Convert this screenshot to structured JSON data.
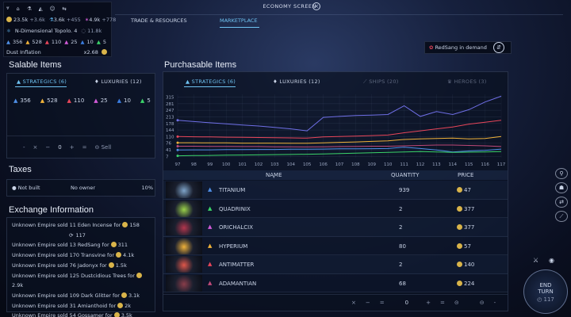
{
  "topbar": {
    "row1": [
      {
        "icon": "fleet-icon",
        "text": ""
      },
      {
        "icon": "city-icon",
        "text": ""
      },
      {
        "icon": "science-icon",
        "text": ""
      },
      {
        "icon": "influence-icon",
        "text": ""
      },
      {
        "icon": "approval-icon",
        "text": ""
      },
      {
        "icon": "diplomacy-icon",
        "text": ""
      }
    ],
    "dust": "23.5k",
    "dust_rate": "+3.6k",
    "science": "3.6k",
    "science_rate": "+455",
    "influence": "4.9k",
    "influence_rate": "+778",
    "research": "N-Dimensional Topolo. 4",
    "research_cost": "11.8k",
    "strategics": [
      {
        "name": "titanium",
        "value": "356",
        "color": "#4f8fe6"
      },
      {
        "name": "quadrinix",
        "value": "528",
        "color": "#f0b23a"
      },
      {
        "name": "orichalcix",
        "value": "110",
        "color": "#e8465a"
      },
      {
        "name": "hyperium",
        "value": "25",
        "color": "#d25bd8"
      },
      {
        "name": "antimatter",
        "value": "10",
        "color": "#3a7de0"
      },
      {
        "name": "adamantian",
        "value": "5",
        "color": "#3bd36a"
      }
    ],
    "dust_inflation_label": "Dust Inflation",
    "dust_inflation_value": "x2.68"
  },
  "header": {
    "title": "ECONOMY SCREEN",
    "tabs": [
      "TRADE & RESOURCES",
      "MARKETPLACE"
    ]
  },
  "demand": {
    "text": "RedSang in demand"
  },
  "salable": {
    "title": "Salable Items",
    "tabs": [
      "STRATEGICS (6)",
      "LUXURIES (12)"
    ],
    "resources": [
      {
        "value": "356",
        "color": "#4f8fe6"
      },
      {
        "value": "528",
        "color": "#f0b23a"
      },
      {
        "value": "110",
        "color": "#e8465a"
      },
      {
        "value": "25",
        "color": "#d25bd8"
      },
      {
        "value": "10",
        "color": "#3a7de0"
      },
      {
        "value": "5",
        "color": "#3bd36a"
      }
    ],
    "controls": {
      "qty": "0",
      "sell": "Sell"
    }
  },
  "taxes": {
    "title": "Taxes",
    "status": "Not built",
    "owner": "No owner",
    "rate": "10%"
  },
  "exchange": {
    "title": "Exchange Information",
    "items": [
      {
        "text": "Unknown Empire sold 11 Eden Incense for",
        "price": "158"
      },
      {
        "text": "",
        "price": "117"
      },
      {
        "text": "Unknown Empire sold 13 RedSang for",
        "price": "311"
      },
      {
        "text": "Unknown Empire sold 170 Transvine for",
        "price": "4.1k"
      },
      {
        "text": "Unknown Empire sold 76 Jadonyx for",
        "price": "1.5k"
      },
      {
        "text": "Unknown Empire sold 125 Dustcidious Trees for",
        "price": "2.9k"
      },
      {
        "text": "Unknown Empire sold 109 Dark Glitter for",
        "price": "3.1k"
      },
      {
        "text": "Unknown Empire sold 31 Amianthoid for",
        "price": "2k"
      },
      {
        "text": "Unknown Empire sold 54 Gossamer for",
        "price": "3.5k"
      }
    ]
  },
  "purchasable": {
    "title": "Purchasable Items",
    "tabs": [
      "STRATEGICS (6)",
      "LUXURIES (12)",
      "SHIPS (20)",
      "HEROES (3)"
    ],
    "columns": [
      "NAME",
      "QUANTITY",
      "PRICE"
    ],
    "rows": [
      {
        "name": "TITANIUM",
        "qty": "939",
        "price": "47",
        "color": "#4f8fe6",
        "thumb": "#7fa4c9"
      },
      {
        "name": "QUADRINIX",
        "qty": "2",
        "price": "377",
        "color": "#3bd36a",
        "thumb": "#9bd24a"
      },
      {
        "name": "ORICHALCIX",
        "qty": "2",
        "price": "377",
        "color": "#d25bd8",
        "thumb": "#b3364d"
      },
      {
        "name": "HYPERIUM",
        "qty": "80",
        "price": "57",
        "color": "#f0b23a",
        "thumb": "#f0b23a"
      },
      {
        "name": "ANTIMATTER",
        "qty": "2",
        "price": "140",
        "color": "#e8465a",
        "thumb": "#e0574a"
      },
      {
        "name": "ADAMANTIAN",
        "qty": "68",
        "price": "224",
        "color": "#c04a7a",
        "thumb": "#8a3d4a"
      }
    ],
    "controls": {
      "qty": "0"
    }
  },
  "end_turn": {
    "label1": "END",
    "label2": "TURN",
    "turn": "117"
  },
  "chart_data": {
    "type": "line",
    "x": [
      97,
      98,
      99,
      100,
      101,
      102,
      103,
      104,
      105,
      106,
      107,
      108,
      109,
      110,
      111,
      112,
      113,
      114,
      115,
      116,
      117
    ],
    "yticks": [
      7,
      41,
      76,
      110,
      144,
      178,
      213,
      247,
      281,
      315
    ],
    "ylim": [
      0,
      330
    ],
    "series": [
      {
        "color": "#6f6fe6",
        "values": [
          195,
          188,
          182,
          176,
          170,
          165,
          158,
          150,
          140,
          210,
          215,
          220,
          222,
          225,
          270,
          215,
          240,
          225,
          250,
          290,
          320
        ]
      },
      {
        "color": "#e8465a",
        "values": [
          110,
          109,
          108,
          107,
          106,
          105,
          104,
          103,
          102,
          108,
          110,
          112,
          115,
          118,
          130,
          140,
          150,
          160,
          175,
          185,
          195
        ]
      },
      {
        "color": "#f0b23a",
        "values": [
          78,
          78,
          77,
          77,
          76,
          76,
          76,
          75,
          75,
          77,
          80,
          82,
          85,
          88,
          95,
          98,
          100,
          102,
          98,
          100,
          110
        ]
      },
      {
        "color": "#c04a7a",
        "values": [
          60,
          60,
          59,
          59,
          58,
          58,
          57,
          57,
          56,
          57,
          58,
          59,
          60,
          60,
          62,
          64,
          66,
          66,
          64,
          62,
          58
        ]
      },
      {
        "color": "#4f8fe6",
        "values": [
          40,
          41,
          41,
          42,
          42,
          43,
          43,
          44,
          44,
          45,
          46,
          46,
          47,
          48,
          55,
          48,
          40,
          30,
          35,
          38,
          45
        ]
      },
      {
        "color": "#3bd36a",
        "values": [
          10,
          11,
          12,
          13,
          14,
          15,
          16,
          17,
          18,
          20,
          22,
          24,
          26,
          28,
          30,
          32,
          30,
          28,
          29,
          30,
          32
        ]
      }
    ]
  }
}
